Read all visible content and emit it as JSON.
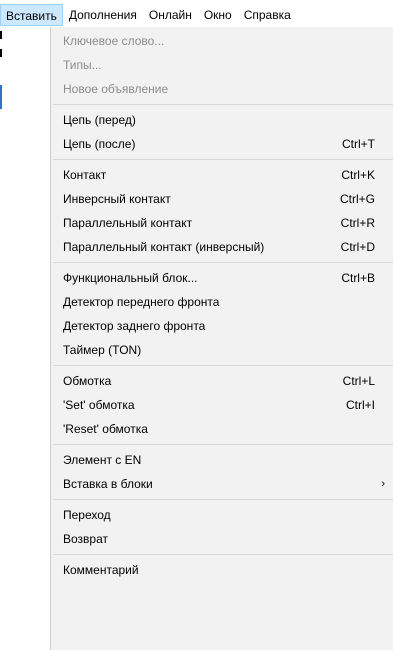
{
  "menubar": {
    "items": [
      {
        "label": "Вставить",
        "active": true
      },
      {
        "label": "Дополнения",
        "active": false
      },
      {
        "label": "Онлайн",
        "active": false
      },
      {
        "label": "Окно",
        "active": false
      },
      {
        "label": "Справка",
        "active": false
      }
    ]
  },
  "menu": {
    "items": {
      "keyword": {
        "label": "Ключевое слово...",
        "shortcut": ""
      },
      "types": {
        "label": "Типы...",
        "shortcut": ""
      },
      "new_declaration": {
        "label": "Новое объявление",
        "shortcut": ""
      },
      "network_before": {
        "label": "Цепь (перед)",
        "shortcut": ""
      },
      "network_after": {
        "label": "Цепь (после)",
        "shortcut": "Ctrl+T"
      },
      "contact": {
        "label": "Контакт",
        "shortcut": "Ctrl+K"
      },
      "negated_contact": {
        "label": "Инверсный контакт",
        "shortcut": "Ctrl+G"
      },
      "parallel_contact": {
        "label": "Параллельный контакт",
        "shortcut": "Ctrl+R"
      },
      "parallel_negated_contact": {
        "label": "Параллельный контакт (инверсный)",
        "shortcut": "Ctrl+D"
      },
      "function_block": {
        "label": "Функциональный блок...",
        "shortcut": "Ctrl+B"
      },
      "rising_edge": {
        "label": "Детектор переднего фронта",
        "shortcut": ""
      },
      "falling_edge": {
        "label": "Детектор заднего фронта",
        "shortcut": ""
      },
      "timer_ton": {
        "label": "Таймер (TON)",
        "shortcut": ""
      },
      "coil": {
        "label": "Обмотка",
        "shortcut": "Ctrl+L"
      },
      "set_coil": {
        "label": "'Set' обмотка",
        "shortcut": "Ctrl+I"
      },
      "reset_coil": {
        "label": "'Reset' обмотка",
        "shortcut": ""
      },
      "element_en": {
        "label": "Элемент с EN",
        "shortcut": ""
      },
      "insert_blocks": {
        "label": "Вставка в блоки",
        "shortcut": ""
      },
      "jump": {
        "label": "Переход",
        "shortcut": ""
      },
      "return": {
        "label": "Возврат",
        "shortcut": ""
      },
      "comment": {
        "label": "Комментарий",
        "shortcut": ""
      }
    },
    "submenu_arrow": "›"
  }
}
